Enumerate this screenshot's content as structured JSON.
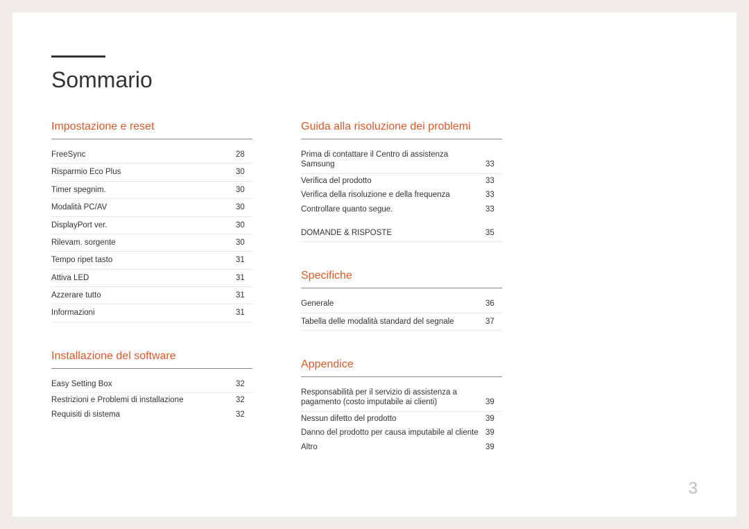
{
  "page_title": "Sommario",
  "page_number": "3",
  "left_column": [
    {
      "heading": "Impostazione e reset",
      "items": [
        {
          "label": "FreeSync",
          "page": "28"
        },
        {
          "label": "Risparmio Eco Plus",
          "page": "30"
        },
        {
          "label": "Timer spegnim.",
          "page": "30"
        },
        {
          "label": "Modalità PC/AV",
          "page": "30"
        },
        {
          "label": "DisplayPort ver.",
          "page": "30"
        },
        {
          "label": "Rilevam. sorgente",
          "page": "30"
        },
        {
          "label": "Tempo ripet tasto",
          "page": "31"
        },
        {
          "label": "Attiva LED",
          "page": "31"
        },
        {
          "label": "Azzerare tutto",
          "page": "31"
        },
        {
          "label": "Informazioni",
          "page": "31"
        }
      ]
    },
    {
      "heading": "Installazione del software",
      "items": [
        {
          "label": "Easy Setting Box",
          "page": "32"
        },
        {
          "label": "Restrizioni e Problemi di installazione",
          "page": "32",
          "noborder": true
        },
        {
          "label": "Requisiti di sistema",
          "page": "32",
          "noborder": true
        }
      ]
    }
  ],
  "right_column": [
    {
      "heading": "Guida alla risoluzione dei problemi",
      "items": [
        {
          "label": "Prima di contattare il Centro di assistenza Samsung",
          "page": "33"
        },
        {
          "label": "Verifica del prodotto",
          "page": "33",
          "noborder": true
        },
        {
          "label": "Verifica della risoluzione e della frequenza",
          "page": "33",
          "noborder": true
        },
        {
          "label": "Controllare quanto segue.",
          "page": "33",
          "noborder": true
        },
        {
          "label": "DOMANDE & RISPOSTE",
          "page": "35",
          "spaced": true
        }
      ]
    },
    {
      "heading": "Specifiche",
      "items": [
        {
          "label": "Generale",
          "page": "36"
        },
        {
          "label": "Tabella delle modalità standard del segnale",
          "page": "37"
        }
      ]
    },
    {
      "heading": "Appendice",
      "items": [
        {
          "label": "Responsabilità per il servizio di assistenza a pagamento (costo imputabile ai clienti)",
          "page": "39"
        },
        {
          "label": "Nessun difetto del prodotto",
          "page": "39",
          "noborder": true
        },
        {
          "label": "Danno del prodotto per causa imputabile al cliente",
          "page": "39",
          "noborder": true
        },
        {
          "label": "Altro",
          "page": "39",
          "noborder": true
        }
      ]
    }
  ]
}
